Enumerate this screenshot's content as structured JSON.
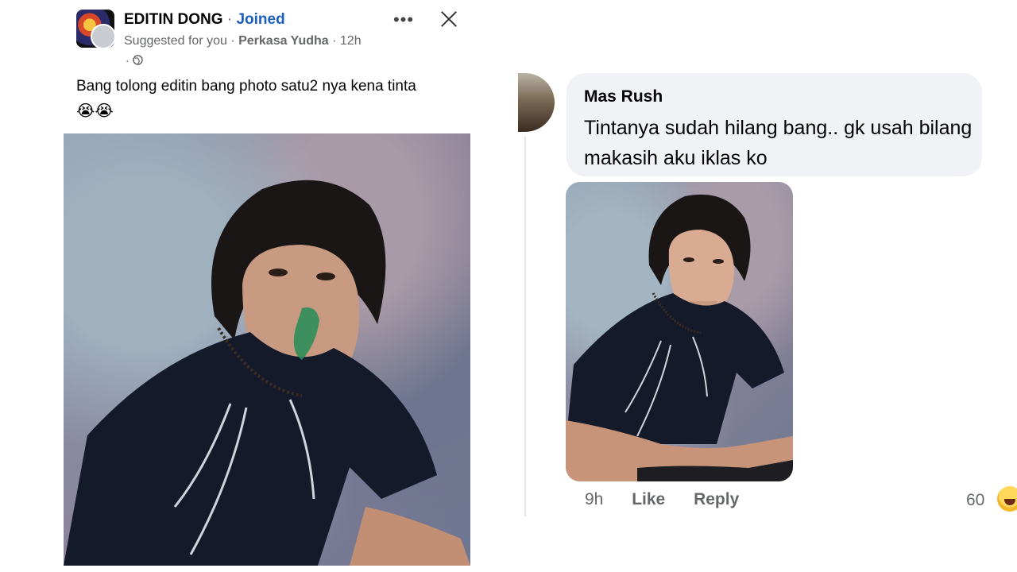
{
  "post": {
    "group_name": "EDITIN DONG",
    "separator": "·",
    "joined_label": "Joined",
    "suggested_label": "Suggested for you",
    "meta_separator": "·",
    "author": "Perkasa Yudha",
    "time": "12h",
    "privacy_prefix": "·",
    "privacy_icon": "globe-icon",
    "more_icon": "more-options-icon",
    "close_icon": "close-icon",
    "text": "Bang tolong editin bang photo satu2 nya kena tinta",
    "emojis": "😭😭",
    "photo_description_icon": "post-photo"
  },
  "comment": {
    "author": "Mas Rush",
    "text": "Tintanya sudah hilang bang.. gk usah bilang makasih aku iklas ko",
    "time": "9h",
    "like_label": "Like",
    "reply_label": "Reply",
    "reaction_count": "60",
    "reaction_icon": "haha-reaction-icon"
  },
  "colors": {
    "joined_blue": "#1d5fbf",
    "bubble_gray": "#f0f2f5",
    "meta_gray": "#65676b"
  }
}
